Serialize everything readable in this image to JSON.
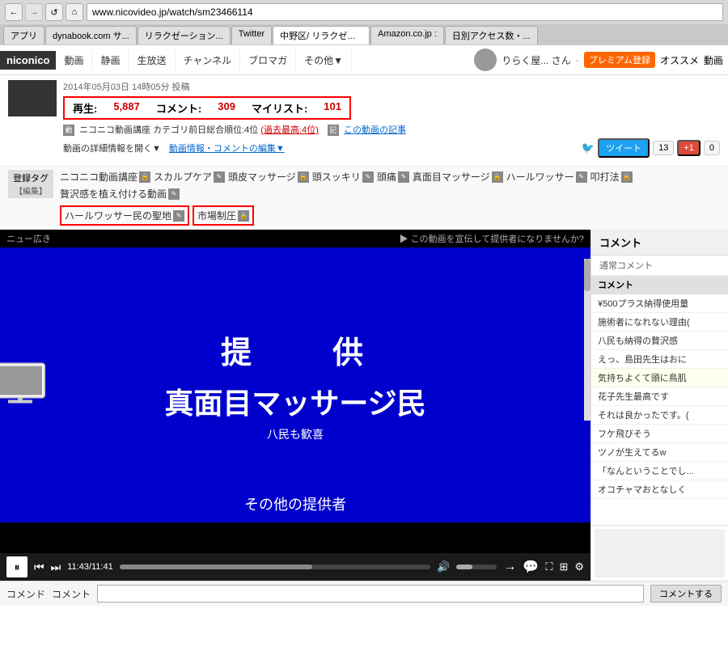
{
  "browser": {
    "address": "www.nicovideo.jp/watch/sm23466114",
    "back_btn": "←",
    "forward_btn": "→",
    "reload_btn": "↺",
    "home_btn": "⌂",
    "tabs": [
      {
        "label": "アプリ",
        "active": false
      },
      {
        "label": "dynabook.com サ...",
        "active": false
      },
      {
        "label": "リラクゼーション...",
        "active": false
      },
      {
        "label": "Twitter",
        "active": false
      },
      {
        "label": "中野区/ リラクゼー...",
        "active": false
      },
      {
        "label": "Amazon.co.jp :",
        "active": false
      },
      {
        "label": "日別アクセス数・...",
        "active": false
      }
    ]
  },
  "nico_header": {
    "logo": "niconico",
    "menu_items": [
      "動画",
      "静画",
      "生放送",
      "チャンネル",
      "ブロマガ",
      "その他▼"
    ],
    "username": "りらく屋... さん",
    "premium_label": "プレミアム登録",
    "osusume_label": "オススメ",
    "video_label": "動画"
  },
  "video_info": {
    "posted_date": "2014年05月03日 14時05分 投稿",
    "stats": {
      "play_label": "再生:",
      "play_count": "5,887",
      "comment_label": "コメント:",
      "comment_count": "309",
      "mylist_label": "マイリスト:",
      "mylist_count": "101"
    },
    "category": {
      "icon_label": "ニコニコ動画講座",
      "text": "カテゴリ前日総合順位:4位",
      "past_best": "(過去最高:4位)",
      "article_link": "この動画の記事"
    },
    "detail_link": "動画の詳細情報を開く▼",
    "edit_link": "動画情報・コメントの編集▼",
    "tweet_label": "ツイート",
    "tweet_count": "13",
    "gplus_label": "+1",
    "gplus_count": "0"
  },
  "tags": {
    "register_label": "登録タグ",
    "edit_label": "【編集】",
    "items": [
      {
        "text": "ニコニコ動画講座",
        "icon": "lock"
      },
      {
        "text": "スカルプケア",
        "icon": "edit"
      },
      {
        "text": "頭皮マッサージ",
        "icon": "lock"
      },
      {
        "text": "頭スッキリ",
        "icon": "edit"
      },
      {
        "text": "頭痛",
        "icon": "edit"
      },
      {
        "text": "真面目マッサージ",
        "icon": "lock"
      },
      {
        "text": "ハールワッサー",
        "icon": "edit"
      },
      {
        "text": "叩打法",
        "icon": "lock"
      },
      {
        "text": "贅沢感を植え付ける動画",
        "icon": "edit"
      },
      {
        "text": "ハールワッサー民の聖地",
        "icon": "edit",
        "highlighted": true
      },
      {
        "text": "市場制圧",
        "icon": "lock",
        "highlighted": true
      }
    ]
  },
  "video": {
    "ad_left": "ニュー広き",
    "ad_right": "▶ この動画を宣伝して提供者になりませんか?",
    "main_title": "提　　供",
    "subtitle": "真面目マッサージ民",
    "sub2": "八民も歓喜",
    "provider_text": "その他の提供者",
    "time_current": "11:43",
    "time_total": "11:41"
  },
  "comment_panel": {
    "header": "コメント",
    "type_label": "通常コメント",
    "comment_label": "コメント",
    "comments": [
      "¥500プラス納得使用量",
      "施術者になれない理由(",
      "八民も納得の贅沢感",
      "えっ、島田先生はおに",
      "気持ちよくて頭に鳥肌",
      "花子先生最高です",
      "それは良かったです。(",
      "フケ飛びそう",
      "ツノが生えてるw",
      "「なんということでし...",
      "オコチャマおとなしく"
    ]
  },
  "controls": {
    "play_icon": "⏸",
    "skip_back": "⏮",
    "skip_fwd": "⏭",
    "volume_icon": "🔊",
    "arrow_icon": "→",
    "chat_icon": "💬",
    "settings_icon": "⚙"
  },
  "command_bar": {
    "cmd_label": "コメンド",
    "comment_label": "コメント",
    "submit_label": "コメントする"
  }
}
